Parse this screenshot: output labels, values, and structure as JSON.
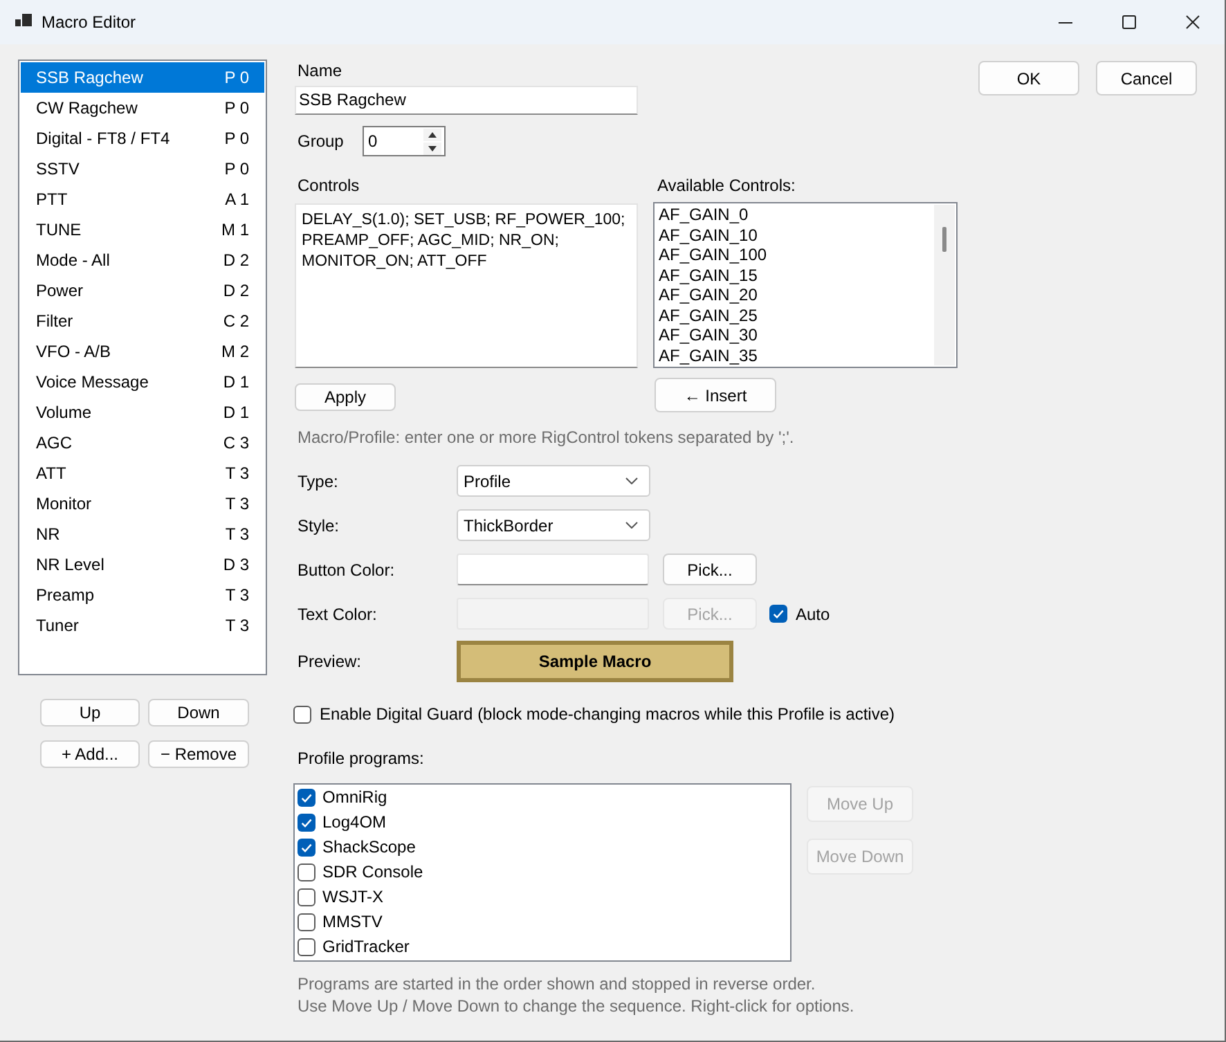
{
  "window": {
    "title": "Macro Editor"
  },
  "macros": [
    {
      "name": "SSB Ragchew",
      "code": "P 0",
      "selected": true
    },
    {
      "name": "CW Ragchew",
      "code": "P 0",
      "selected": false
    },
    {
      "name": "Digital - FT8 / FT4",
      "code": "P 0",
      "selected": false
    },
    {
      "name": "SSTV",
      "code": "P 0",
      "selected": false
    },
    {
      "name": "PTT",
      "code": "A 1",
      "selected": false
    },
    {
      "name": "TUNE",
      "code": "M 1",
      "selected": false
    },
    {
      "name": "Mode - All",
      "code": "D 2",
      "selected": false
    },
    {
      "name": "Power",
      "code": "D 2",
      "selected": false
    },
    {
      "name": "Filter",
      "code": "C 2",
      "selected": false
    },
    {
      "name": "VFO - A/B",
      "code": "M 2",
      "selected": false
    },
    {
      "name": "Voice Message",
      "code": "D 1",
      "selected": false
    },
    {
      "name": "Volume",
      "code": "D 1",
      "selected": false
    },
    {
      "name": "AGC",
      "code": "C 3",
      "selected": false
    },
    {
      "name": "ATT",
      "code": "T 3",
      "selected": false
    },
    {
      "name": "Monitor",
      "code": "T 3",
      "selected": false
    },
    {
      "name": "NR",
      "code": "T 3",
      "selected": false
    },
    {
      "name": "NR Level",
      "code": "D 3",
      "selected": false
    },
    {
      "name": "Preamp",
      "code": "T 3",
      "selected": false
    },
    {
      "name": "Tuner",
      "code": "T 3",
      "selected": false
    }
  ],
  "list_buttons": [
    "Up",
    "Down",
    "+ Add...",
    "− Remove"
  ],
  "name": {
    "label": "Name",
    "value": "SSB Ragchew"
  },
  "group": {
    "label": "Group",
    "value": "0"
  },
  "controls": {
    "label": "Controls",
    "value": "DELAY_S(1.0); SET_USB; RF_POWER_100; PREAMP_OFF; AGC_MID; NR_ON; MONITOR_ON; ATT_OFF",
    "apply_button": "Apply"
  },
  "available_controls": {
    "label": "Available Controls:",
    "items": [
      "AF_GAIN_0",
      "AF_GAIN_10",
      "AF_GAIN_100",
      "AF_GAIN_15",
      "AF_GAIN_20",
      "AF_GAIN_25",
      "AF_GAIN_30",
      "AF_GAIN_35"
    ],
    "insert_button": "← Insert"
  },
  "hint": "Macro/Profile: enter one or more RigControl tokens separated by ';'.",
  "selects": [
    {
      "label": "Type:",
      "value": "Profile"
    },
    {
      "label": "Style:",
      "value": "ThickBorder"
    }
  ],
  "color_fields": [
    {
      "label": "Button Color:",
      "disabled": false,
      "pick_button": "Pick..."
    },
    {
      "label": "Text Color:",
      "disabled": true,
      "pick_button": "Pick...",
      "auto": {
        "label": "Auto",
        "checked": true
      }
    }
  ],
  "preview": {
    "label": "Preview:",
    "sample": "Sample Macro"
  },
  "digital_guard": {
    "label": "Enable Digital Guard (block mode-changing macros while this Profile is active)",
    "checked": false
  },
  "profile_programs": {
    "label": "Profile programs:",
    "items": [
      {
        "name": "OmniRig",
        "checked": true
      },
      {
        "name": "Log4OM",
        "checked": true
      },
      {
        "name": "ShackScope",
        "checked": true
      },
      {
        "name": "SDR Console",
        "checked": false
      },
      {
        "name": "WSJT-X",
        "checked": false
      },
      {
        "name": "MMSTV",
        "checked": false
      },
      {
        "name": "GridTracker",
        "checked": false
      }
    ],
    "buttons": [
      {
        "label": "Move Up",
        "disabled": true
      },
      {
        "label": "Move Down",
        "disabled": true
      }
    ],
    "notes": [
      "Programs are started in the order shown and stopped in reverse order.",
      "Use Move Up / Move Down to change the sequence. Right-click for options."
    ]
  },
  "dialog_buttons": [
    "OK",
    "Cancel"
  ]
}
